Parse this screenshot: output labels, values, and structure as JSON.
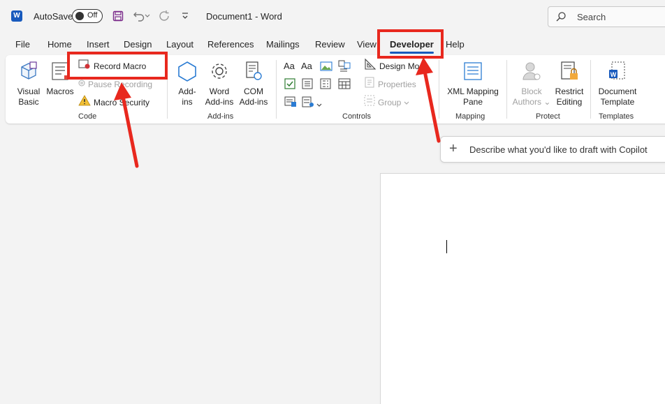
{
  "titlebar": {
    "autosave_label": "AutoSave",
    "autosave_state": "Off",
    "document_title": "Document1  -  Word",
    "search_placeholder": "Search"
  },
  "tabs": [
    "File",
    "Home",
    "Insert",
    "Design",
    "Layout",
    "References",
    "Mailings",
    "Review",
    "View",
    "Developer",
    "Help"
  ],
  "active_tab": "Developer",
  "ribbon": {
    "code": {
      "group_label": "Code",
      "visual_basic": [
        "Visual",
        "Basic"
      ],
      "macros": "Macros",
      "record_macro": "Record Macro",
      "pause_recording": "Pause Recording",
      "macro_security": "Macro Security"
    },
    "addins": {
      "group_label": "Add-ins",
      "addins": [
        "Add-",
        "ins"
      ],
      "word_addins": [
        "Word",
        "Add-ins"
      ],
      "com_addins": [
        "COM",
        "Add-ins"
      ]
    },
    "controls": {
      "group_label": "Controls",
      "design_mode": "Design Mode",
      "properties": "Properties",
      "group": "Group"
    },
    "mapping": {
      "group_label": "Mapping",
      "xml_mapping": [
        "XML Mapping",
        "Pane"
      ]
    },
    "protect": {
      "group_label": "Protect",
      "block_authors": [
        "Block",
        "Authors"
      ],
      "restrict_editing": [
        "Restrict",
        "Editing"
      ]
    },
    "templates": {
      "group_label": "Templates",
      "document_template": [
        "Document",
        "Template"
      ]
    }
  },
  "copilot_prompt": "Describe what you'd like to draft with Copilot",
  "colors": {
    "word_blue": "#185abd",
    "annotation_red": "#e8281e"
  }
}
